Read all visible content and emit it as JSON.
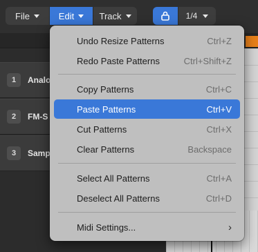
{
  "toolbar": {
    "file": "File",
    "edit": "Edit",
    "track": "Track",
    "quantize": "1/4"
  },
  "tracks": [
    {
      "num": "1",
      "name": "Analo"
    },
    {
      "num": "2",
      "name": "FM-S"
    },
    {
      "num": "3",
      "name": "Samp"
    }
  ],
  "menu": {
    "undo": {
      "label": "Undo Resize Patterns",
      "shortcut": "Ctrl+Z"
    },
    "redo": {
      "label": "Redo Paste Patterns",
      "shortcut": "Ctrl+Shift+Z"
    },
    "copy": {
      "label": "Copy Patterns",
      "shortcut": "Ctrl+C"
    },
    "paste": {
      "label": "Paste Patterns",
      "shortcut": "Ctrl+V"
    },
    "cut": {
      "label": "Cut Patterns",
      "shortcut": "Ctrl+X"
    },
    "clear": {
      "label": "Clear Patterns",
      "shortcut": "Backspace"
    },
    "select_all": {
      "label": "Select All Patterns",
      "shortcut": "Ctrl+A"
    },
    "deselect_all": {
      "label": "Deselect All Patterns",
      "shortcut": "Ctrl+D"
    },
    "midi": {
      "label": "Midi Settings...",
      "shortcut": "›"
    }
  },
  "colors": {
    "accent": "#3a78d8",
    "menu_bg": "#bfbfbf",
    "ruler_marker": "#e8801a"
  }
}
